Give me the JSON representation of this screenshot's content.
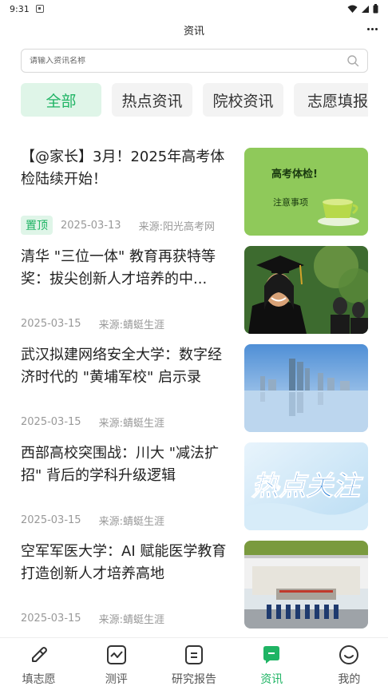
{
  "status_bar": {
    "time": "9:31"
  },
  "header": {
    "title": "资讯"
  },
  "search": {
    "placeholder": "请输入资讯名称"
  },
  "tabs": [
    {
      "label": "全部",
      "active": true
    },
    {
      "label": "热点资讯",
      "active": false
    },
    {
      "label": "院校资讯",
      "active": false
    },
    {
      "label": "志愿填报",
      "active": false
    }
  ],
  "news": [
    {
      "title": "【@家长】3月！2025年高考体检陆续开始！",
      "pinned": true,
      "pin_label": "置顶",
      "date": "2025-03-13",
      "source": "来源:阳光高考网",
      "thumb": {
        "headline": "高考体检!",
        "subline": "注意事项",
        "bg": "#8fc95a"
      }
    },
    {
      "title": "清华 \"三位一体\" 教育再获特等奖：拔尖创新人才培养的中...",
      "pinned": false,
      "date": "2025-03-15",
      "source": "来源:蜻蜓生涯",
      "thumb": {
        "bg": "#3d6b2f"
      }
    },
    {
      "title": "武汉拟建网络安全大学：数字经济时代的 \"黄埔军校\" 启示录",
      "pinned": false,
      "date": "2025-03-15",
      "source": "来源:蜻蜓生涯",
      "thumb": {
        "bg": "#6aa8e0"
      }
    },
    {
      "title": "西部高校突围战：川大 \"减法扩招\" 背后的学科升级逻辑",
      "pinned": false,
      "date": "2025-03-15",
      "source": "来源:蜻蜓生涯",
      "thumb": {
        "headline": "热点关注",
        "bg": "#cfe8f7"
      }
    },
    {
      "title": "空军军医大学：AI 赋能医学教育 打造创新人才培养高地",
      "pinned": false,
      "date": "2025-03-15",
      "source": "来源:蜻蜓生涯",
      "thumb": {
        "bg": "#8aa7c4"
      }
    }
  ],
  "bottom_nav": [
    {
      "label": "填志愿",
      "icon": "pencil-icon",
      "active": false
    },
    {
      "label": "测评",
      "icon": "chart-icon",
      "active": false
    },
    {
      "label": "研究报告",
      "icon": "document-icon",
      "active": false
    },
    {
      "label": "资讯",
      "icon": "message-icon",
      "active": true
    },
    {
      "label": "我的",
      "icon": "smile-icon",
      "active": false
    }
  ],
  "colors": {
    "accent": "#1fb464",
    "accent_bg": "#dff5e8"
  }
}
